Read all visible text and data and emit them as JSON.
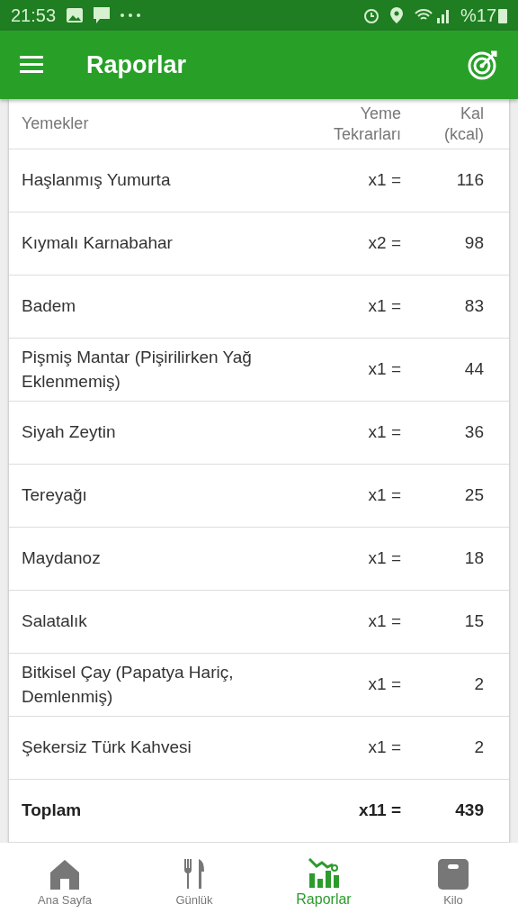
{
  "status_bar": {
    "time": "21:53",
    "battery": "%17"
  },
  "app_bar": {
    "title": "Raporlar"
  },
  "table": {
    "columns": [
      "Yemekler",
      "Yeme Tekrarları",
      "Kal (kcal)"
    ],
    "rows": [
      {
        "name": "Haşlanmış Yumurta",
        "count": "x1 =",
        "kcal": "116"
      },
      {
        "name": "Kıymalı Karnabahar",
        "count": "x2 =",
        "kcal": "98"
      },
      {
        "name": "Badem",
        "count": "x1 =",
        "kcal": "83"
      },
      {
        "name": "Pişmiş Mantar (Pişirilirken Yağ Eklenmemiş)",
        "count": "x1 =",
        "kcal": "44"
      },
      {
        "name": "Siyah Zeytin",
        "count": "x1 =",
        "kcal": "36"
      },
      {
        "name": "Tereyağı",
        "count": "x1 =",
        "kcal": "25"
      },
      {
        "name": "Maydanoz",
        "count": "x1 =",
        "kcal": "18"
      },
      {
        "name": "Salatalık",
        "count": "x1 =",
        "kcal": "15"
      },
      {
        "name": "Bitkisel Çay (Papatya Hariç, Demlenmiş)",
        "count": "x1 =",
        "kcal": "2"
      },
      {
        "name": "Şekersiz Türk Kahvesi",
        "count": "x1 =",
        "kcal": "2"
      }
    ],
    "total": {
      "name": "Toplam",
      "count": "x11 =",
      "kcal": "439"
    }
  },
  "bottom_nav": [
    {
      "kind": "home",
      "label": "Ana Sayfa",
      "selected": false
    },
    {
      "kind": "diary",
      "label": "Günlük",
      "selected": false
    },
    {
      "kind": "reports",
      "label": "Raporlar",
      "selected": true
    },
    {
      "kind": "weight",
      "label": "Kilo",
      "selected": false
    }
  ]
}
